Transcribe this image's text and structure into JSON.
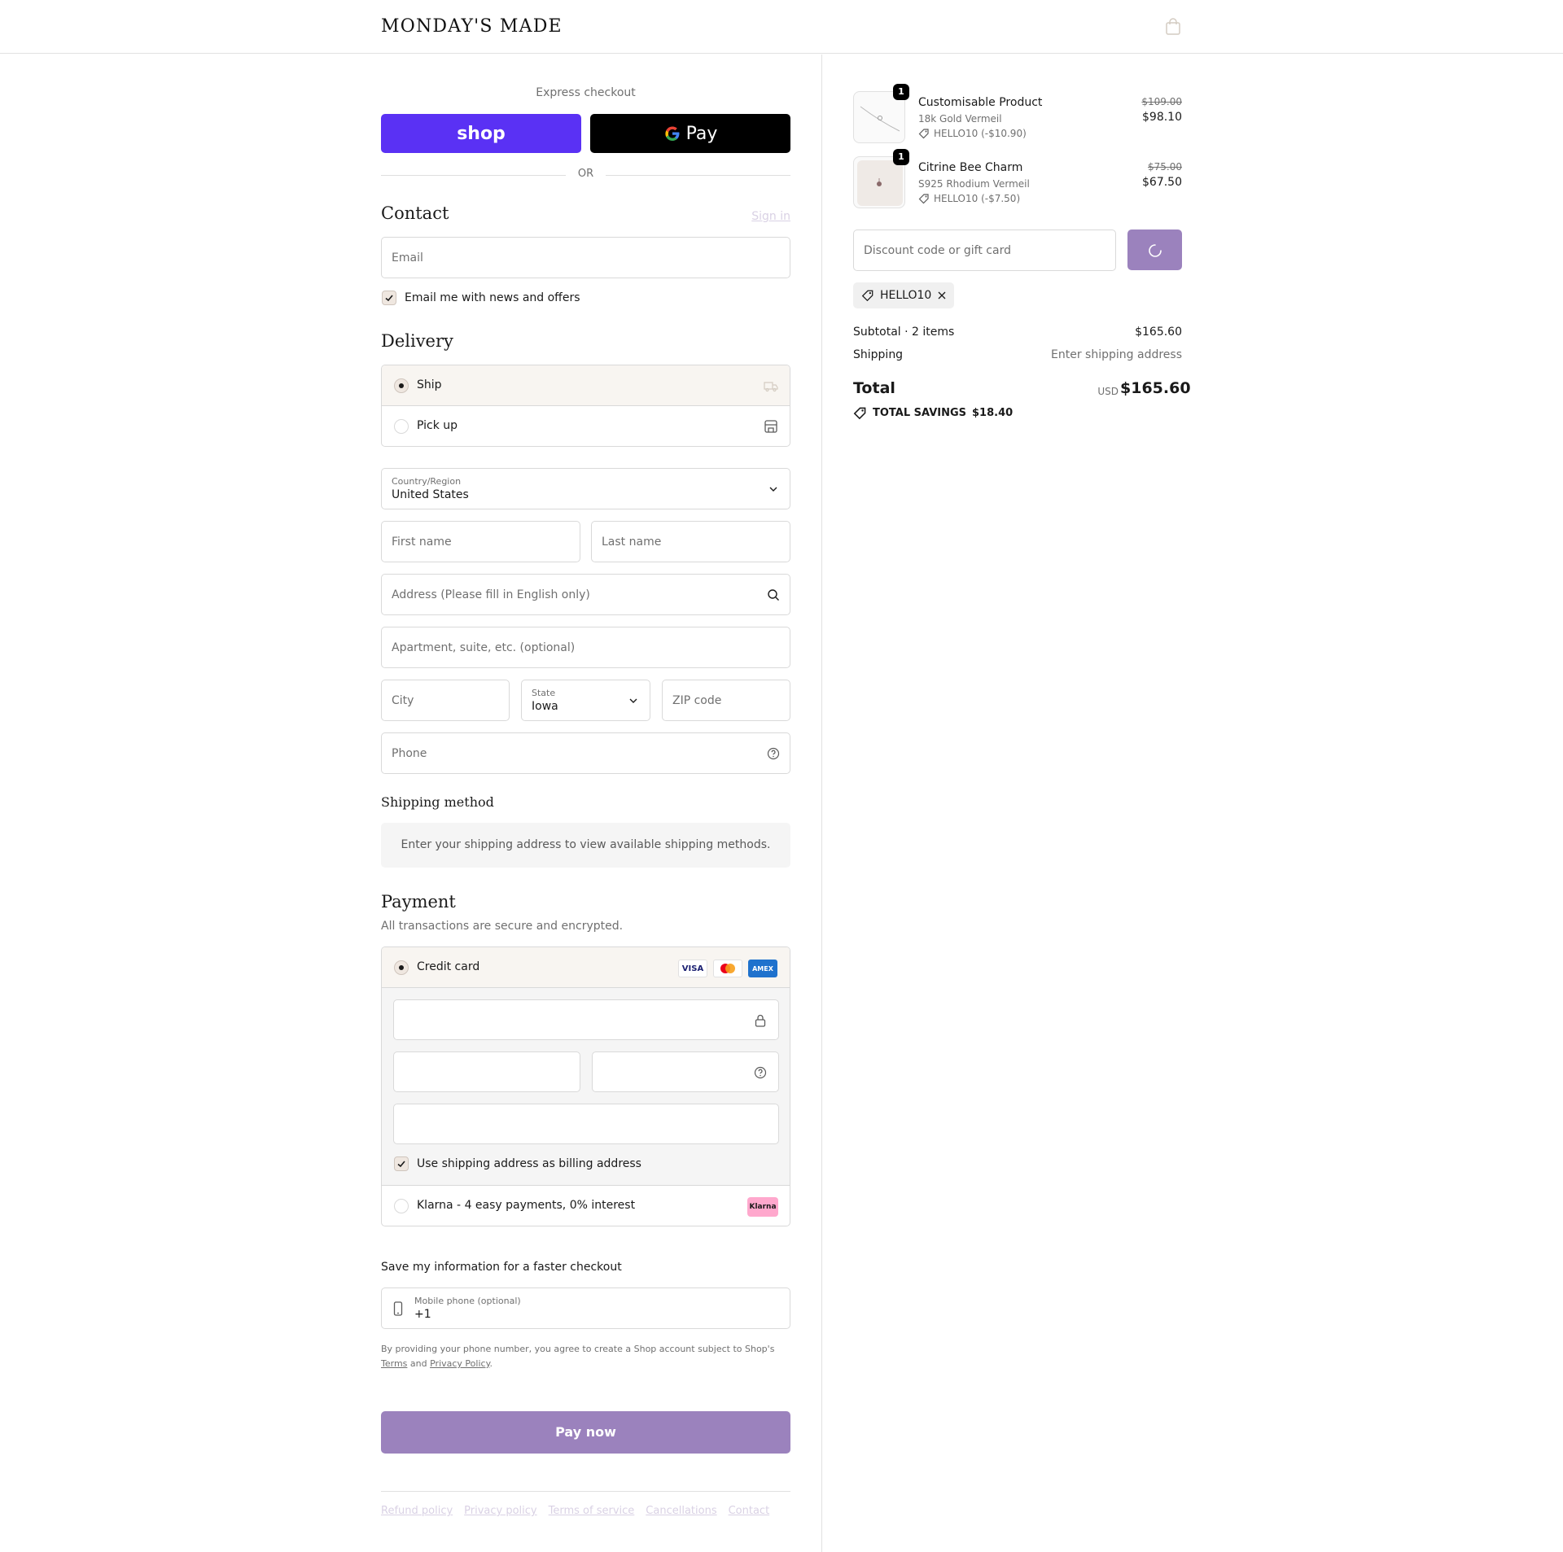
{
  "header": {
    "brand": "MONDAY'S MADE",
    "cart_icon": "shopping-bag-icon"
  },
  "express": {
    "label": "Express checkout",
    "shop_pay_label": "shop",
    "gpay_label": "Pay",
    "or_label": "OR"
  },
  "contact": {
    "title": "Contact",
    "sign_in": "Sign in",
    "email_placeholder": "Email",
    "newsletter_label": "Email me with news and offers",
    "newsletter_checked": true
  },
  "delivery": {
    "title": "Delivery",
    "options": [
      {
        "label": "Ship",
        "selected": true,
        "icon": "truck-icon"
      },
      {
        "label": "Pick up",
        "selected": false,
        "icon": "store-icon"
      }
    ],
    "country_label": "Country/Region",
    "country_value": "United States",
    "first_name_placeholder": "First name",
    "last_name_placeholder": "Last name",
    "address_placeholder": "Address (Please fill in English only)",
    "apartment_placeholder": "Apartment, suite, etc. (optional)",
    "city_placeholder": "City",
    "state_label": "State",
    "state_value": "Iowa",
    "zip_placeholder": "ZIP code",
    "phone_placeholder": "Phone"
  },
  "shipping_method": {
    "title": "Shipping method",
    "empty_message": "Enter your shipping address to view available shipping methods."
  },
  "payment": {
    "title": "Payment",
    "subtitle": "All transactions are secure and encrypted.",
    "credit_card_label": "Credit card",
    "card_brands": [
      "VISA",
      "",
      "AMEX"
    ],
    "billing_same_label": "Use shipping address as billing address",
    "billing_same_checked": true,
    "klarna_label": "Klarna - 4 easy payments, 0% interest",
    "klarna_badge": "Klarna"
  },
  "save_info": {
    "title": "Save my information for a faster checkout",
    "mobile_label": "Mobile phone (optional)",
    "mobile_value": "+1",
    "legal_prefix": "By providing your phone number, you agree to create a Shop account subject to Shop's",
    "terms_link": "Terms",
    "and_text": "and",
    "privacy_link": "Privacy Policy",
    "legal_suffix": "."
  },
  "pay_now_label": "Pay now",
  "footer_links": [
    "Refund policy",
    "Privacy policy",
    "Terms of service",
    "Cancellations",
    "Contact"
  ],
  "order": {
    "items": [
      {
        "quantity": "1",
        "name": "Customisable Product",
        "variant": "18k Gold Vermeil",
        "discount": "HELLO10 (-$10.90)",
        "original_price": "$109.00",
        "price": "$98.10"
      },
      {
        "quantity": "1",
        "name": "Citrine Bee Charm",
        "variant": "S925 Rhodium Vermeil",
        "discount": "HELLO10 (-$7.50)",
        "original_price": "$75.00",
        "price": "$67.50"
      }
    ],
    "discount_placeholder": "Discount code or gift card",
    "applied_code": "HELLO10",
    "subtotal_label": "Subtotal · 2 items",
    "subtotal_value": "$165.60",
    "shipping_label": "Shipping",
    "shipping_value": "Enter shipping address",
    "total_label": "Total",
    "currency": "USD",
    "total_value": "$165.60",
    "savings_label": "TOTAL SAVINGS",
    "savings_value": "$18.40"
  },
  "colors": {
    "shop_pay": "#5a31f4",
    "accent_purple": "#9b82bd",
    "selected_bg": "#f8f5f1"
  }
}
